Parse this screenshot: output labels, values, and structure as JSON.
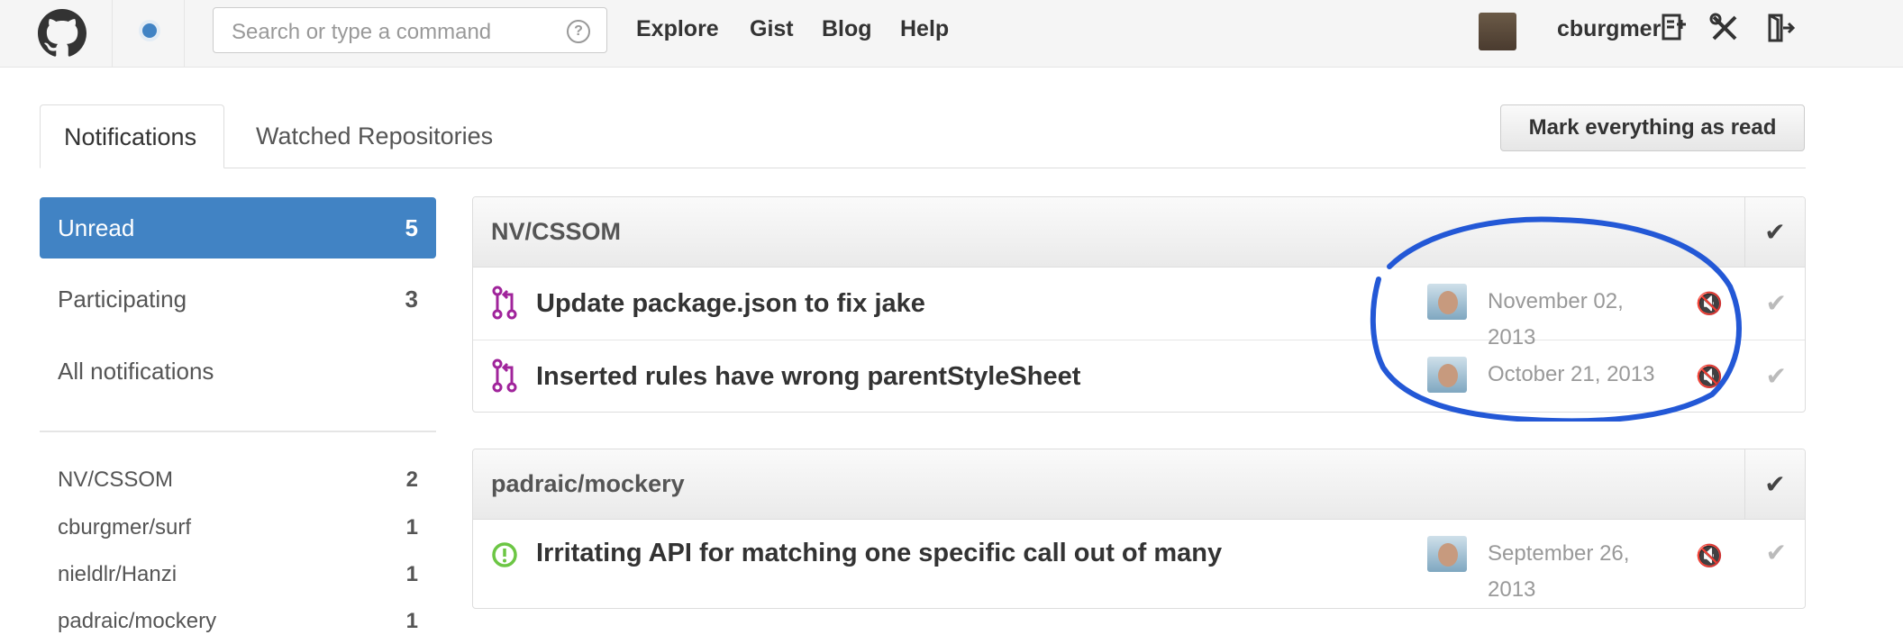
{
  "header": {
    "search_placeholder": "Search or type a command",
    "search_help_icon": "question-circle-icon",
    "nav": [
      "Explore",
      "Gist",
      "Blog",
      "Help"
    ],
    "username": "cburgmer",
    "icons": [
      "octocat-logo-icon",
      "notification-dot-icon",
      "create-repo-icon",
      "settings-tools-icon",
      "sign-out-icon"
    ]
  },
  "tabs": {
    "notifications": "Notifications",
    "watched": "Watched Repositories"
  },
  "mark_all_label": "Mark everything as read",
  "sidebar": {
    "filters": [
      {
        "label": "Unread",
        "count": "5"
      },
      {
        "label": "Participating",
        "count": "3"
      },
      {
        "label": "All notifications",
        "count": ""
      }
    ],
    "repos": [
      {
        "label": "NV/CSSOM",
        "count": "2"
      },
      {
        "label": "cburgmer/surf",
        "count": "1"
      },
      {
        "label": "nieldlr/Hanzi",
        "count": "1"
      },
      {
        "label": "padraic/mockery",
        "count": "1"
      }
    ]
  },
  "groups": [
    {
      "repo": "NV/CSSOM",
      "items": [
        {
          "icon": "pull-request-icon",
          "title": "Update package.json to fix jake",
          "date": "November 02, 2013"
        },
        {
          "icon": "pull-request-icon",
          "title": "Inserted rules have wrong parentStyleSheet",
          "date": "October 21, 2013"
        }
      ]
    },
    {
      "repo": "padraic/mockery",
      "items": [
        {
          "icon": "issue-opened-icon",
          "title": "Irritating API for matching one specific call out of many",
          "date": "September 26, 2013"
        }
      ]
    }
  ],
  "colors": {
    "accent": "#4183c4",
    "pull_request": "#a0249b",
    "issue_open": "#6cc644",
    "annotation": "#2358d6"
  }
}
